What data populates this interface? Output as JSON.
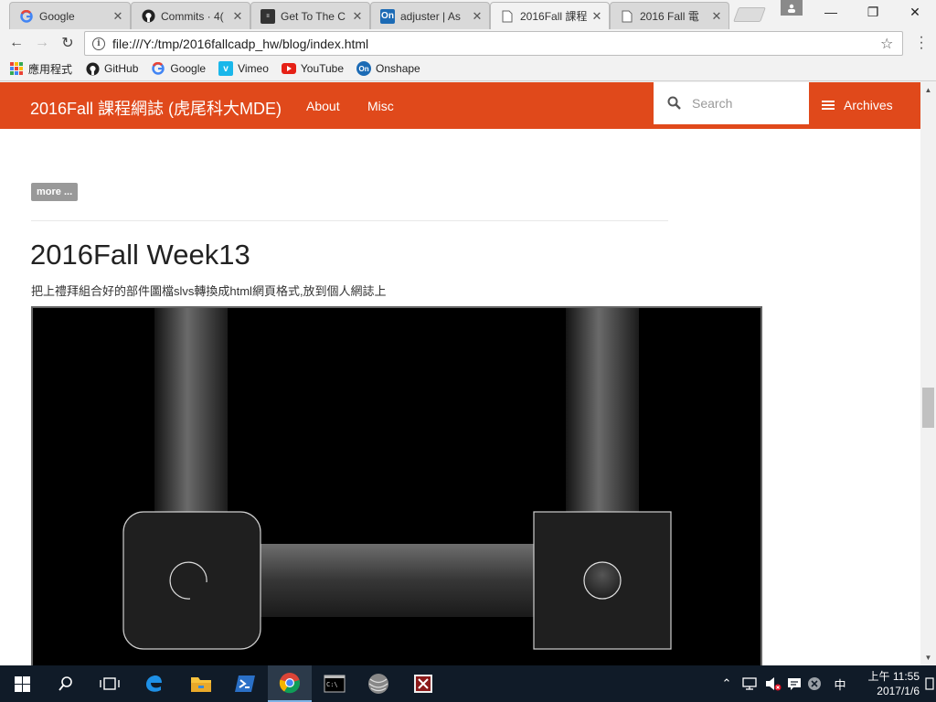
{
  "browser": {
    "tabs": [
      {
        "title": "Google",
        "icon": "google-icon"
      },
      {
        "title": "Commits · 4(",
        "icon": "github-icon"
      },
      {
        "title": "Get To The C",
        "icon": "knowyourmeme-icon"
      },
      {
        "title": "adjuster | As",
        "icon": "onshape-icon",
        "icon_text": "On"
      },
      {
        "title": "2016Fall 課程",
        "icon": "page-icon"
      },
      {
        "title": "2016 Fall 電",
        "icon": "page-icon"
      }
    ],
    "active_tab_index": 4,
    "url": "file:///Y:/tmp/2016fallcadp_hw/blog/index.html",
    "bookmarks": [
      {
        "label": "應用程式",
        "icon": "apps-icon"
      },
      {
        "label": "GitHub",
        "icon": "github-icon"
      },
      {
        "label": "Google",
        "icon": "google-icon"
      },
      {
        "label": "Vimeo",
        "icon": "vimeo-icon"
      },
      {
        "label": "YouTube",
        "icon": "youtube-icon"
      },
      {
        "label": "Onshape",
        "icon": "onshape-icon",
        "icon_text": "On"
      }
    ]
  },
  "site": {
    "brand": "2016Fall 課程網誌 (虎尾科大MDE)",
    "nav": [
      "About",
      "Misc"
    ],
    "search_placeholder": "Search",
    "archives_label": "Archives",
    "accent_color": "#e0491b"
  },
  "content": {
    "more_label": "more ...",
    "post_title": "2016Fall Week13",
    "post_description": "把上禮拜組合好的部件圖檔slvs轉換成html網頁格式,放到個人網誌上"
  },
  "taskbar": {
    "clock_period": "上午",
    "clock_time": "11:55",
    "date": "2017/1/6",
    "pinned": [
      "windows-start-icon",
      "search-icon",
      "task-view-icon",
      "edge-icon",
      "file-explorer-icon",
      "powershell-icon",
      "chrome-icon",
      "cmd-icon",
      "sphere-app-icon",
      "solvespace-icon"
    ],
    "active_item": "chrome-icon"
  }
}
